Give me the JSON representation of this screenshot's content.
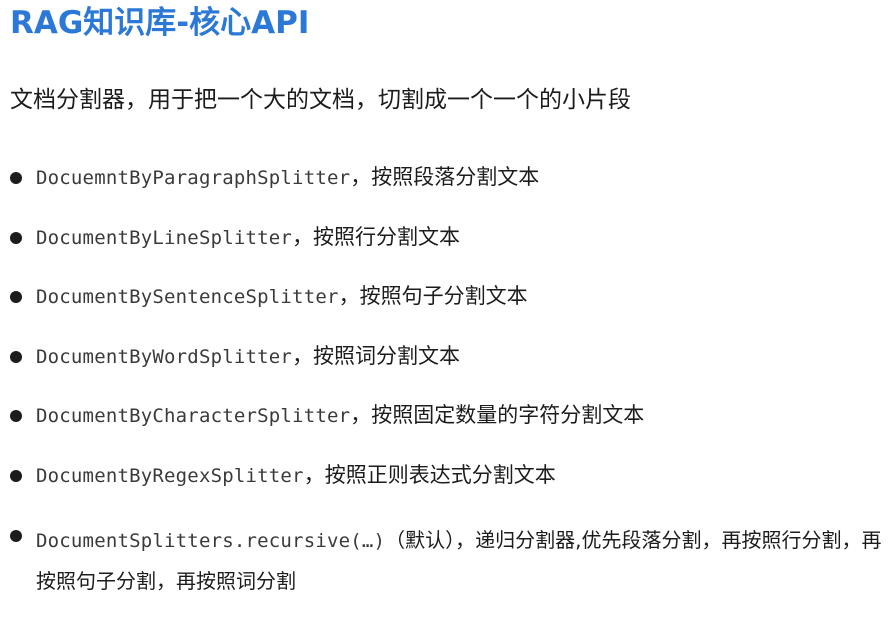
{
  "title": "RAG知识库-核心API",
  "subtitle": "文档分割器，用于把一个大的文档，切割成一个一个的小片段",
  "items": [
    {
      "code": "DocuemntByParagraphSplitter",
      "desc": "，按照段落分割文本"
    },
    {
      "code": "DocumentByLineSplitter",
      "desc": "，按照行分割文本"
    },
    {
      "code": "DocumentBySentenceSplitter",
      "desc": "，按照句子分割文本"
    },
    {
      "code": "DocumentByWordSplitter",
      "desc": "，按照词分割文本"
    },
    {
      "code": "DocumentByCharacterSplitter",
      "desc": "，按照固定数量的字符分割文本"
    },
    {
      "code": "DocumentByRegexSplitter",
      "desc": "，按照正则表达式分割文本"
    },
    {
      "code": "DocumentSplitters.recursive(…)",
      "desc": "（默认），递归分割器,优先段落分割，再按照行分割，再按照句子分割，再按照词分割"
    }
  ]
}
